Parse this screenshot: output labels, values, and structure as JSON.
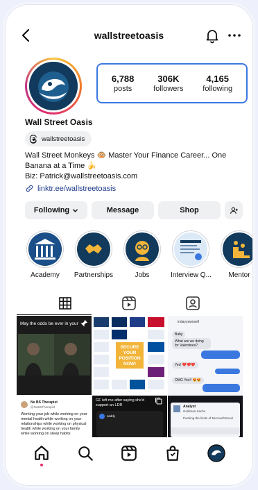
{
  "header": {
    "username": "wallstreetoasis"
  },
  "profile": {
    "display_name": "Wall Street Oasis",
    "threads_handle": "wallstreetoasis",
    "bio_line1": "Wall Street Monkeys 🐵 Master Your Finance Career... One",
    "bio_line2": "Banana at a Time 🍌",
    "bio_line3": "Biz: Patrick@wallstreetoasis.com",
    "link": "linktr.ee/wallstreetoasis"
  },
  "stats": [
    {
      "value": "6,788",
      "label": "posts"
    },
    {
      "value": "306K",
      "label": "followers"
    },
    {
      "value": "4,165",
      "label": "following"
    }
  ],
  "buttons": {
    "following": "Following",
    "message": "Message",
    "shop": "Shop"
  },
  "highlights": [
    {
      "label": "Academy"
    },
    {
      "label": "Partnerships"
    },
    {
      "label": "Jobs"
    },
    {
      "label": "Interview Q..."
    },
    {
      "label": "Mentor"
    }
  ],
  "posts": {
    "p1_caption": "May the odds be ever in your",
    "p2_text": "SECURE YOUR POSITION NOW!",
    "p3_header": "indayyawnsell",
    "p3_msg1": "Baby",
    "p3_msg2": "What are we doing for Valentines?",
    "p3_msg3": "Yes! ❤️❤️❤️",
    "p3_msg4": "OMG Yes!! 😍😍",
    "p4_name": "No BS Therapist",
    "p4_handle": "@NoBSTherapist",
    "p4_text": "Working your job while working on your mental health while working on your relationships while working on physical health while working on your family while working on sleep habits",
    "p5_title": "GF left me after saying she'd support an LDR",
    "p5_user": "saddy",
    "p6_title": "Analyst",
    "p6_firm": "Goldman Sachs",
    "p6_detail": "Pushing the limits of Microsoft Excel"
  },
  "colors": {
    "link": "#1e3a8a",
    "accent_border": "#3a78e0",
    "brand_navy": "#123a5c"
  }
}
